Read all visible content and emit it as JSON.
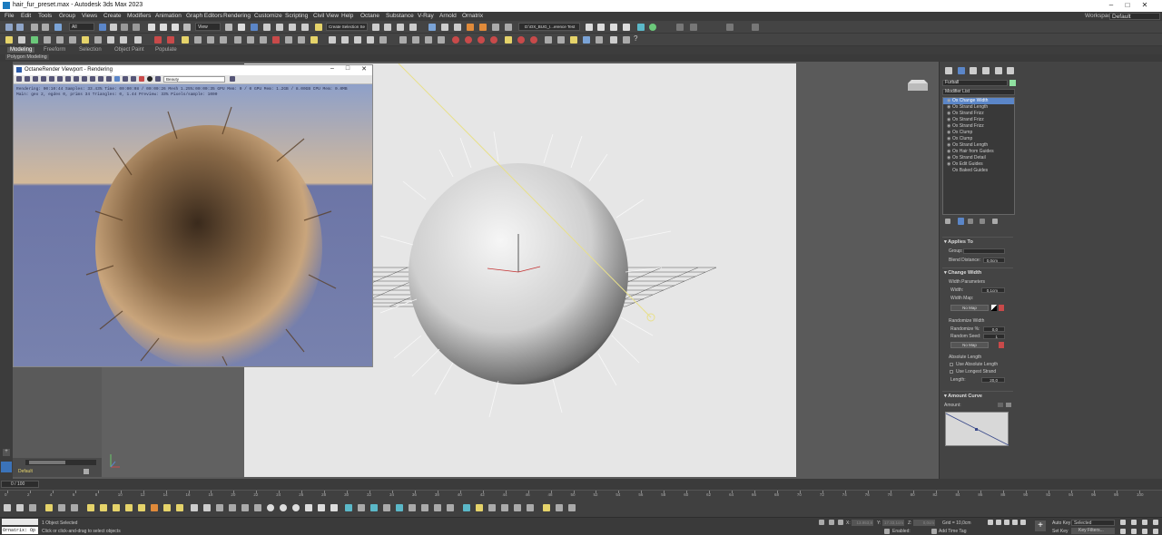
{
  "window": {
    "title": "hair_fur_preset.max - Autodesk 3ds Max 2023"
  },
  "menu": [
    "File",
    "Edit",
    "Tools",
    "Group",
    "Views",
    "Create",
    "Modifiers",
    "Animation",
    "Graph Editors",
    "Rendering",
    "Customize",
    "Scripting",
    "Civil View",
    "Help",
    "Octane",
    "Substance",
    "V-Ray",
    "Arnold",
    "Ornatrix"
  ],
  "workspace": {
    "label": "Workspaces:",
    "value": "Default"
  },
  "toolbar": {
    "selection_filter": "All",
    "view_dropdown": "View",
    "selection_set": "Create Selection Se",
    "path_field": "D:\\OX_BUG_I...erence Test"
  },
  "ribbon": {
    "tabs": [
      "Modeling",
      "Freeform",
      "Selection",
      "Object Paint",
      "Populate"
    ],
    "active": "Modeling",
    "sub": "Polygon Modeling"
  },
  "octane": {
    "title": "OctaneRender Viewport - Rendering",
    "pass": "Beauty",
    "stats_line1": "Rendering: 00:10:44   Samples: 33.43%   Time: 00:00:08 / 00:00:26   Mesh 1.25%:00:00:35   GPU Mem: 0 / 0   GPU Mem: 1.2GB / 8.00GB   CPU Mem: 0.0MB",
    "stats_line2": "Main: geo 2, egdes 0, prims 34  Triangles: 0, 1.44  Preview: 33%   Pixels/sample: 1000"
  },
  "command_panel": {
    "object_name": "Furball",
    "modifier_list_label": "Modifier List",
    "stack": [
      {
        "label": "Ox Change Width",
        "selected": true
      },
      {
        "label": "Ox Strand Length",
        "selected": false
      },
      {
        "label": "Ox Strand Frizz",
        "selected": false
      },
      {
        "label": "Ox Strand Frizz",
        "selected": false
      },
      {
        "label": "Ox Strand Frizz",
        "selected": false
      },
      {
        "label": "Ox Clump",
        "selected": false
      },
      {
        "label": "Ox Clump",
        "selected": false
      },
      {
        "label": "Ox Strand Length",
        "selected": false
      },
      {
        "label": "Ox Hair from Guides",
        "selected": false
      },
      {
        "label": "Ox Strand Detail",
        "selected": false
      },
      {
        "label": "Ox Edit Guides",
        "selected": false
      },
      {
        "label": "Ox Baked Guides",
        "selected": false
      }
    ],
    "applies_to": {
      "title": "Applies To",
      "group_label": "Group:",
      "blend_label": "Blend Distance:",
      "blend_value": "0,0cm"
    },
    "change_width": {
      "title": "Change Width",
      "width_params": "Width Parameters",
      "width_label": "Width:",
      "width_value": "0,1cm",
      "width_map_label": "Width Map:",
      "no_map": "No Map",
      "randomize_width": "Randomize Width",
      "randomize_pct_label": "Randomize %:",
      "randomize_pct_value": "0,0",
      "random_seed_label": "Random Seed:",
      "random_seed_value": "1",
      "no_map2": "No Map",
      "absolute_length": "Absolute Length",
      "use_absolute": "Use Absolute Length",
      "use_longest": "Use Longest Strand",
      "length_label": "Length:",
      "length_value": "20,0"
    },
    "amount_curve": {
      "title": "Amount Curve",
      "amount_label": "Amount:"
    }
  },
  "timeline": {
    "frame": "0 / 100",
    "layer": "Default",
    "ruler_ticks": [
      "0",
      "2",
      "4",
      "6",
      "8",
      "10",
      "12",
      "14",
      "16",
      "18",
      "20",
      "22",
      "24",
      "26",
      "28",
      "30",
      "32",
      "34",
      "36",
      "38",
      "40",
      "42",
      "44",
      "46",
      "48",
      "50",
      "52",
      "54",
      "56",
      "58",
      "60",
      "62",
      "64",
      "66",
      "68",
      "70",
      "72",
      "74",
      "76",
      "78",
      "80",
      "82",
      "84",
      "86",
      "88",
      "90",
      "92",
      "94",
      "96",
      "98",
      "100"
    ]
  },
  "status": {
    "selected": "1 Object Selected",
    "hint": "Click or click-and-drag to select objects",
    "script": "Ornatrix: Op",
    "grid": "Grid = 10,0cm",
    "add_time_tag": "Add Time Tag",
    "enabled": "Enabled:",
    "auto_key": "Auto Key",
    "set_key": "Set Key",
    "selected_dropdown": "Selected",
    "key_filters": "Key Filters...",
    "coord_x": "X:",
    "coord_y": "Y:",
    "coord_z": "Z:",
    "coord_x_val": "13.953,8",
    "coord_y_val": "17.33,1cm",
    "coord_z_val": "0,0cm"
  },
  "colors": {
    "selection_blue": "#5b86c8",
    "octane_sky": "#8ea0c9",
    "gizmo_red": "#c43030",
    "light_yellow": "#e8e08a"
  }
}
